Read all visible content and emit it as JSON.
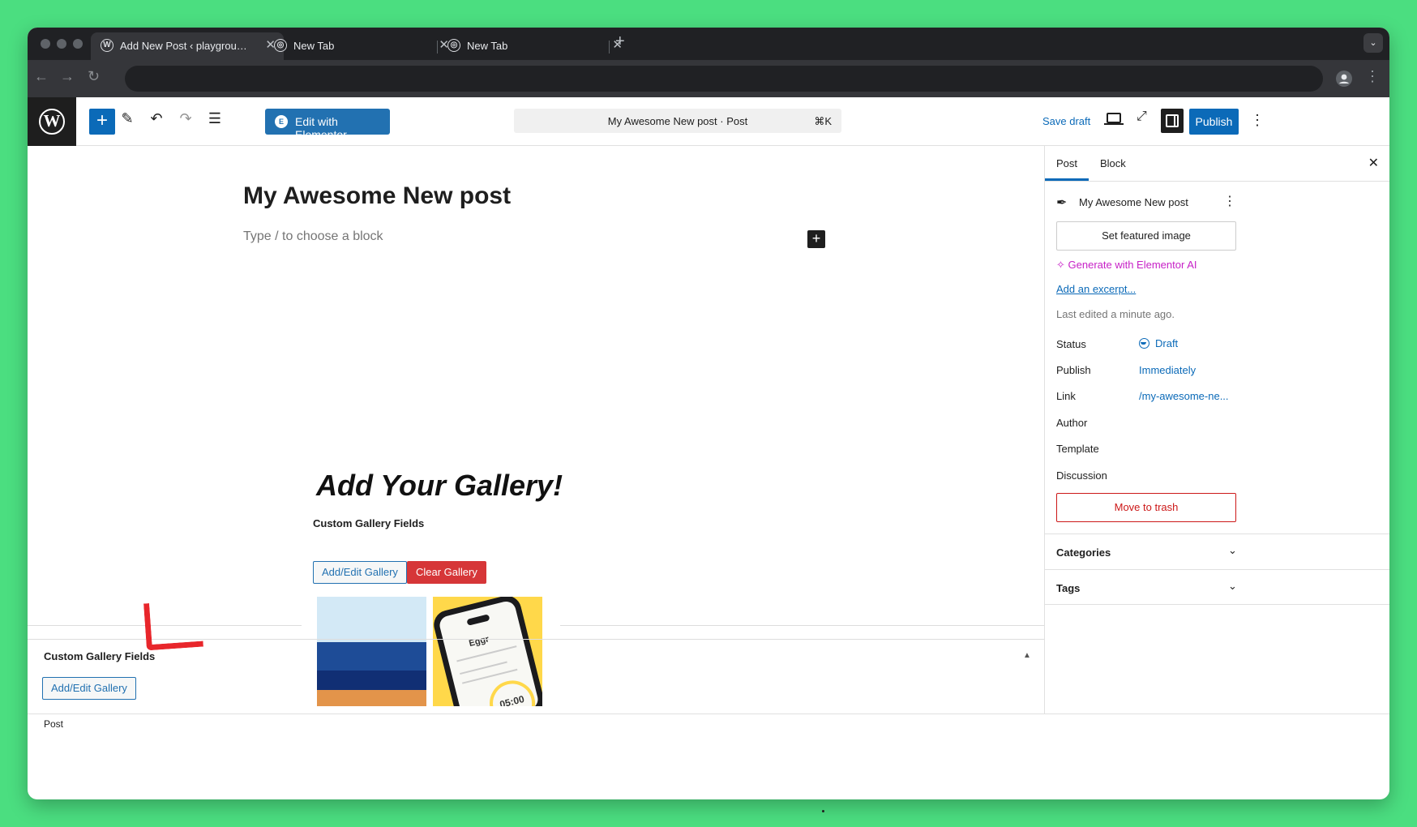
{
  "browser": {
    "tabs": [
      {
        "title": "Add New Post ‹ playground — WordPress",
        "active": true,
        "icon": "wordpress-icon"
      },
      {
        "title": "New Tab",
        "active": false,
        "icon": "chrome-icon"
      },
      {
        "title": "New Tab",
        "active": false,
        "icon": "chrome-icon"
      }
    ],
    "address": ""
  },
  "toolbar": {
    "elementor_label": "Edit with Elementor",
    "command_title": "My Awesome New post · Post",
    "command_shortcut": "⌘K",
    "save_draft": "Save draft",
    "publish": "Publish"
  },
  "editor": {
    "post_title": "My Awesome New post",
    "block_placeholder": "Type / to choose a block",
    "gallery_heading": "Add Your Gallery!",
    "gallery_fields_label": "Custom Gallery Fields",
    "add_edit_gallery": "Add/Edit Gallery",
    "clear_gallery": "Clear Gallery",
    "phone_app_name": "Eggr",
    "phone_timer": "05:00"
  },
  "metabox": {
    "title": "Custom Gallery Fields",
    "add_edit_gallery": "Add/Edit Gallery"
  },
  "sidebar": {
    "tabs": [
      "Post",
      "Block"
    ],
    "post_title": "My Awesome New post",
    "featured_image": "Set featured image",
    "generate_ai": "Generate with Elementor AI",
    "add_excerpt": "Add an excerpt...",
    "last_edited": "Last edited a minute ago.",
    "rows": [
      {
        "label": "Status",
        "value": "Draft"
      },
      {
        "label": "Publish",
        "value": "Immediately"
      },
      {
        "label": "Link",
        "value": "/my-awesome-ne..."
      },
      {
        "label": "Author",
        "value": ""
      },
      {
        "label": "Template",
        "value": ""
      },
      {
        "label": "Discussion",
        "value": ""
      }
    ],
    "move_to_trash": "Move to trash",
    "panels": [
      "Categories",
      "Tags"
    ]
  },
  "footer": {
    "breadcrumb": "Post"
  },
  "colors": {
    "wp_blue": "#0b6ab8",
    "elementor_blue": "#2271b1",
    "clear_red": "#d63638",
    "ai_magenta": "#c721c7",
    "trash_red": "#cc1818",
    "background_green": "#4bde80"
  }
}
